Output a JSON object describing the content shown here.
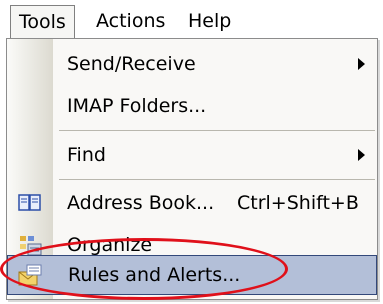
{
  "menubar": {
    "items": [
      {
        "label": "Tools",
        "open": true
      },
      {
        "label": "Actions",
        "open": false
      },
      {
        "label": "Help",
        "open": false
      }
    ]
  },
  "menu": {
    "items": [
      {
        "label": "Send/Receive",
        "submenu": true
      },
      {
        "label": "IMAP Folders...",
        "submenu": false
      },
      {
        "label": "Find",
        "submenu": true
      },
      {
        "label": "Address Book...",
        "shortcut": "Ctrl+Shift+B",
        "icon": "address-book-icon"
      },
      {
        "label": "Organize",
        "icon": "organize-icon"
      },
      {
        "label": "Rules and Alerts...",
        "icon": "rules-alerts-icon",
        "highlighted": true
      }
    ]
  },
  "colors": {
    "highlight": "#b3bfd8",
    "highlight_border": "#33487a",
    "annotation_ellipse": "#e0101a"
  }
}
